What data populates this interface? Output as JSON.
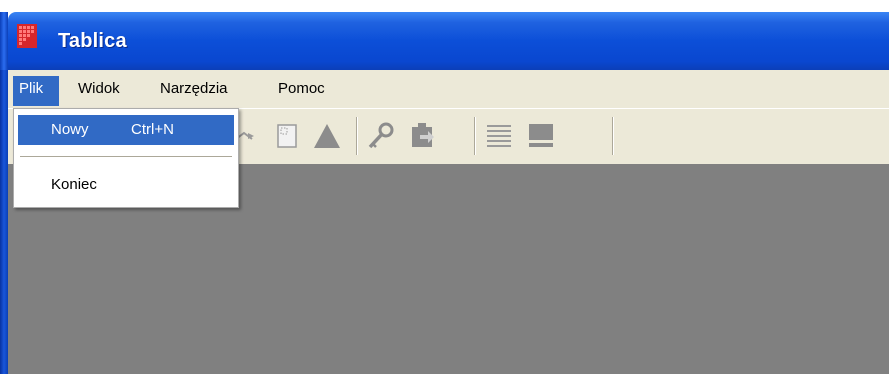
{
  "window": {
    "title": "Tablica",
    "titlebar_color": "#0c4fd8"
  },
  "menubar": {
    "items": [
      {
        "label": "Plik",
        "active": true
      },
      {
        "label": "Widok"
      },
      {
        "label": "Narzędzia"
      },
      {
        "label": "Pomoc"
      }
    ]
  },
  "dropdown": {
    "items": [
      {
        "label": "Nowy",
        "shortcut": "Ctrl+N",
        "highlighted": true
      },
      {
        "label": "Koniec"
      }
    ]
  },
  "toolbar": {
    "icons": [
      "redo-icon",
      "page-icon",
      "triangle-icon",
      "key-icon",
      "export-icon",
      "list-icon",
      "monitor-icon"
    ]
  },
  "colors": {
    "menu_highlight": "#316ac5",
    "client_background": "#808080",
    "chrome": "#ece9d8"
  }
}
